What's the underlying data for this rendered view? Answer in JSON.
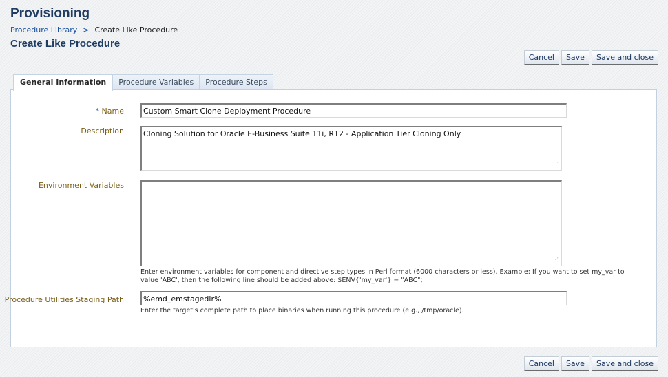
{
  "header": {
    "title": "Provisioning",
    "breadcrumb": [
      {
        "label": "Procedure Library",
        "link": true
      },
      {
        "label": "Create Like Procedure",
        "link": false
      }
    ],
    "breadcrumb_separator": ">",
    "subtitle": "Create Like Procedure"
  },
  "actions": {
    "cancel_label": "Cancel",
    "save_label": "Save",
    "save_close_label": "Save and close"
  },
  "tabs": [
    {
      "label": "General Information",
      "active": true
    },
    {
      "label": "Procedure Variables",
      "active": false
    },
    {
      "label": "Procedure Steps",
      "active": false
    }
  ],
  "form": {
    "name": {
      "required_marker": "*",
      "label": "Name",
      "value": "Custom Smart Clone Deployment Procedure"
    },
    "description": {
      "label": "Description",
      "value": "Cloning Solution for Oracle E-Business Suite 11i, R12 - Application Tier Cloning Only"
    },
    "environment_variables": {
      "label": "Environment Variables",
      "value": "",
      "hint_line1": "Enter environment variables for component and directive step types in Perl format (6000 characters or less). Example: If you want to set my_var to",
      "hint_line2": "value 'ABC', then the following line should be added above: $ENV{'my_var'} = \"ABC\";"
    },
    "staging_path": {
      "label": "Procedure Utilities Staging Path",
      "value": "%emd_emstagedir%",
      "hint": "Enter the target's complete path to place binaries when running this procedure (e.g., /tmp/oracle)."
    }
  },
  "icons": {
    "resize_grip": "⋰"
  }
}
